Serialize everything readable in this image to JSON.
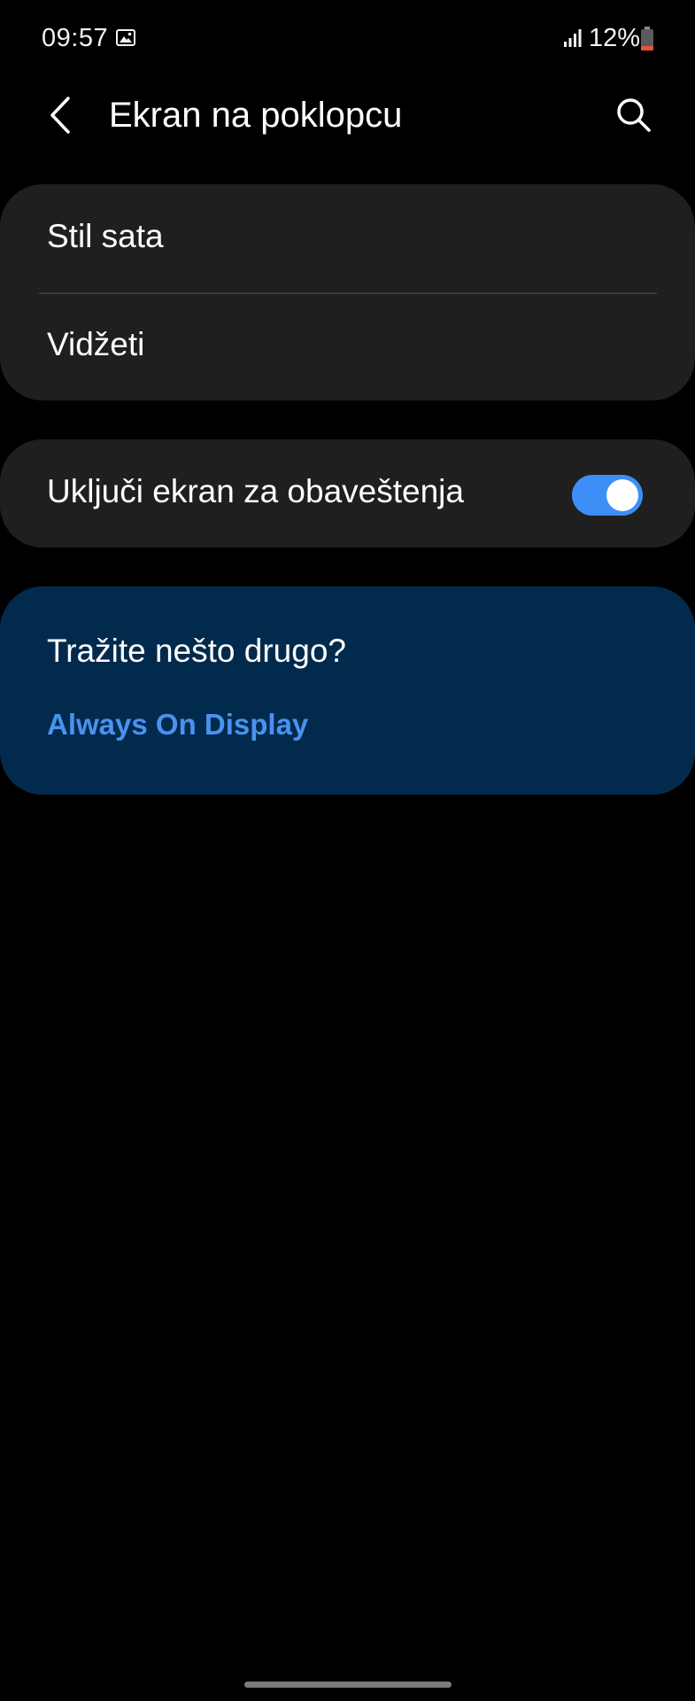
{
  "status_bar": {
    "time": "09:57",
    "battery": "12%",
    "icons": [
      "gallery-icon",
      "signal-icon",
      "battery-icon"
    ]
  },
  "header": {
    "title": "Ekran na poklopcu",
    "back_icon": "chevron-left-icon",
    "search_icon": "search-icon"
  },
  "menu": {
    "items": [
      {
        "label": "Stil sata"
      },
      {
        "label": "Vidžeti"
      }
    ]
  },
  "notification_toggle": {
    "label": "Uključi ekran za obaveštenja",
    "enabled": true
  },
  "suggestion": {
    "title": "Tražite nešto drugo?",
    "link": "Always On Display"
  },
  "colors": {
    "background": "#000000",
    "card": "#1f1f1f",
    "suggestion_card": "#022a4d",
    "accent": "#3e8ef7",
    "link": "#4a92f0",
    "battery_low": "#e2543e"
  }
}
